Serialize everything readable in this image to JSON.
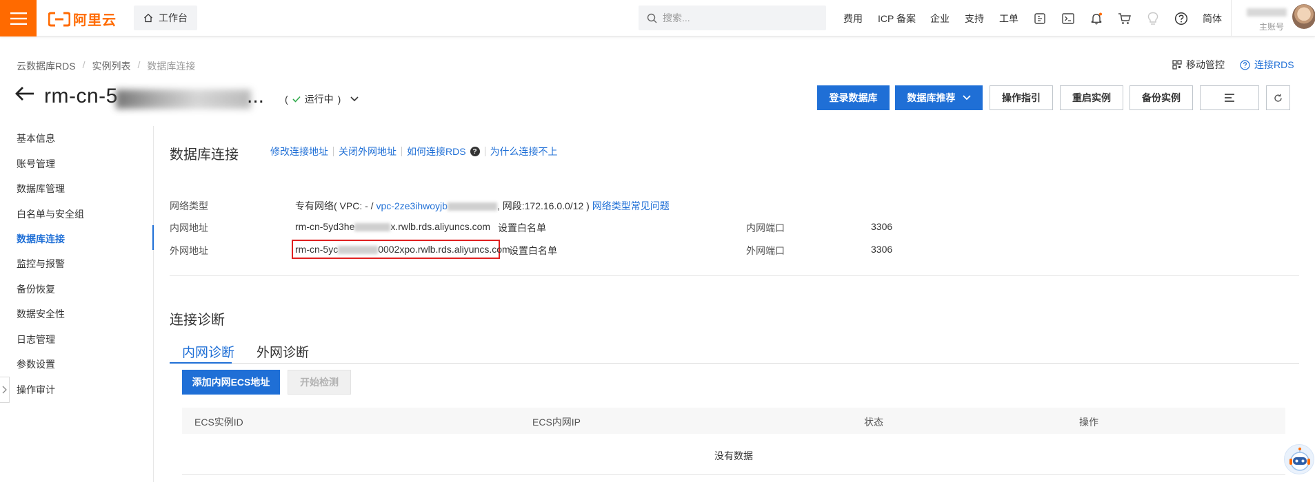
{
  "topbar": {
    "logo_text": "阿里云",
    "workbench": "工作台",
    "search_placeholder": "搜索...",
    "nav": [
      "费用",
      "ICP 备案",
      "企业",
      "支持",
      "工单"
    ],
    "lang": "简体",
    "account_sub": "主账号"
  },
  "breadcrumb": [
    "云数据库RDS",
    "实例列表",
    "数据库连接"
  ],
  "top_links": {
    "mobile": "移动管控",
    "connect": "连接RDS"
  },
  "instance": {
    "title_prefix": "rm-cn-5",
    "title_suffix": "...",
    "status": "运行中"
  },
  "header_buttons": {
    "login": "登录数据库",
    "recommend": "数据库推荐",
    "guide": "操作指引",
    "restart": "重启实例",
    "backup": "备份实例"
  },
  "sidebar": {
    "items": [
      "基本信息",
      "账号管理",
      "数据库管理",
      "白名单与安全组",
      "数据库连接",
      "监控与报警",
      "备份恢复",
      "数据安全性",
      "日志管理",
      "参数设置",
      "操作审计"
    ],
    "active_index": 4
  },
  "db_connection": {
    "title": "数据库连接",
    "links": [
      "修改连接地址",
      "关闭外网地址",
      "如何连接RDS",
      "为什么连接不上"
    ],
    "network_type_label": "网络类型",
    "network_type_prefix": "专有网络( VPC: - / ",
    "vpc_link": "vpc-2ze3ihwoyjb",
    "network_segment": ", 网段:172.16.0.0/12 )",
    "network_faq": "网络类型常见问题",
    "intranet_label": "内网地址",
    "intranet_addr_a": "rm-cn-5yd3he",
    "intranet_addr_b": "x.rwlb.rds.aliyuncs.com",
    "intranet_whitelist": "设置白名单",
    "intranet_port_label": "内网端口",
    "intranet_port": "3306",
    "extranet_label": "外网地址",
    "extranet_addr_a": "rm-cn-5yc",
    "extranet_addr_b": "0002xpo.rwlb.rds.aliyuncs.com",
    "extranet_whitelist": "设置白名单",
    "extranet_port_label": "外网端口",
    "extranet_port": "3306"
  },
  "diagnosis": {
    "title": "连接诊断",
    "tabs": [
      "内网诊断",
      "外网诊断"
    ],
    "add_button": "添加内网ECS地址",
    "start_button": "开始检测",
    "columns": [
      "ECS实例ID",
      "ECS内网IP",
      "状态",
      "操作"
    ],
    "empty": "没有数据"
  },
  "colors": {
    "brand": "#ff6a00",
    "primary": "#1f6fd6",
    "highlight_box": "#e02020"
  }
}
